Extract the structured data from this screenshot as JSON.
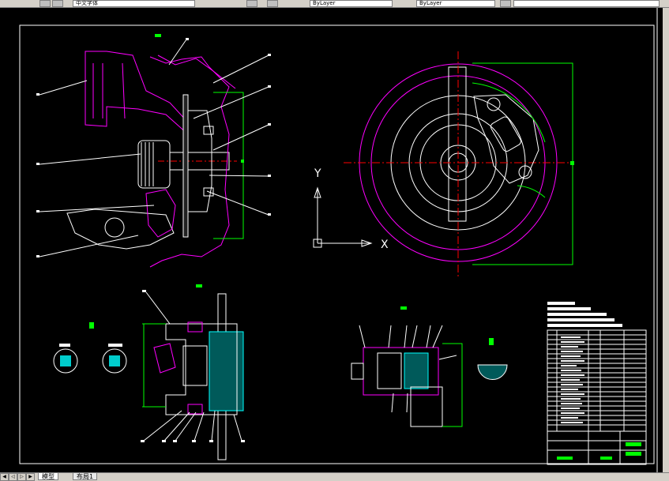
{
  "toolbar": {
    "text_style_value": "中文字体",
    "layer_value": "ByLayer",
    "linetype_value": "ByLayer"
  },
  "ucs": {
    "x_label": "X",
    "y_label": "Y"
  },
  "tabs": [
    {
      "label": "模型"
    },
    {
      "label": "布局1"
    }
  ],
  "colors": {
    "background": "#000000",
    "outline": "#ffffff",
    "part": "#ff00ff",
    "dimension": "#00ff00",
    "centerline": "#ff0000",
    "hatch": "#00ffff"
  }
}
